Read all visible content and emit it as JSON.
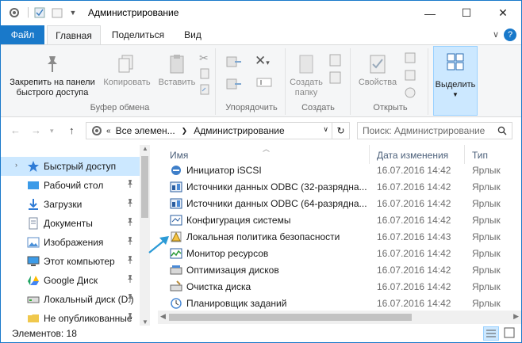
{
  "titlebar": {
    "title": "Администрирование",
    "minimize_glyph": "—",
    "maximize_glyph": "☐",
    "close_glyph": "✕"
  },
  "tabs": {
    "file": "Файл",
    "home": "Главная",
    "share": "Поделиться",
    "view": "Вид",
    "help": "?"
  },
  "ribbon": {
    "pin_label_1": "Закрепить на панели",
    "pin_label_2": "быстрого доступа",
    "copy": "Копировать",
    "paste": "Вставить",
    "group_clipboard": "Буфер обмена",
    "group_organize": "Упорядочить",
    "new_folder_1": "Создать",
    "new_folder_2": "папку",
    "group_create": "Создать",
    "properties": "Свойства",
    "group_open": "Открыть",
    "select": "Выделить"
  },
  "address": {
    "crumb_1": "Все элемен...",
    "crumb_2": "Администрирование",
    "search_placeholder": "Поиск: Администрирование"
  },
  "nav": {
    "items": [
      {
        "label": "Быстрый доступ",
        "icon": "star-icon",
        "pinned": false,
        "selected": true
      },
      {
        "label": "Рабочий стол",
        "icon": "desktop-icon",
        "pinned": true,
        "selected": false
      },
      {
        "label": "Загрузки",
        "icon": "download-icon",
        "pinned": true,
        "selected": false
      },
      {
        "label": "Документы",
        "icon": "documents-icon",
        "pinned": true,
        "selected": false
      },
      {
        "label": "Изображения",
        "icon": "pictures-icon",
        "pinned": true,
        "selected": false
      },
      {
        "label": "Этот компьютер",
        "icon": "computer-icon",
        "pinned": true,
        "selected": false
      },
      {
        "label": "Google Диск",
        "icon": "google-drive-icon",
        "pinned": true,
        "selected": false
      },
      {
        "label": "Локальный диск (D:)",
        "icon": "drive-icon",
        "pinned": true,
        "selected": false
      },
      {
        "label": "Не опубликованные",
        "icon": "folder-icon",
        "pinned": true,
        "selected": false
      }
    ]
  },
  "columns": {
    "name": "Имя",
    "date": "Дата изменения",
    "type": "Тип"
  },
  "files": [
    {
      "name": "Инициатор iSCSI",
      "date": "16.07.2016 14:42",
      "type": "Ярлык"
    },
    {
      "name": "Источники данных ODBC (32-разрядна...",
      "date": "16.07.2016 14:42",
      "type": "Ярлык"
    },
    {
      "name": "Источники данных ODBC (64-разрядна...",
      "date": "16.07.2016 14:42",
      "type": "Ярлык"
    },
    {
      "name": "Конфигурация системы",
      "date": "16.07.2016 14:42",
      "type": "Ярлык"
    },
    {
      "name": "Локальная политика безопасности",
      "date": "16.07.2016 14:43",
      "type": "Ярлык"
    },
    {
      "name": "Монитор ресурсов",
      "date": "16.07.2016 14:42",
      "type": "Ярлык"
    },
    {
      "name": "Оптимизация дисков",
      "date": "16.07.2016 14:42",
      "type": "Ярлык"
    },
    {
      "name": "Очистка диска",
      "date": "16.07.2016 14:42",
      "type": "Ярлык"
    },
    {
      "name": "Планировщик заданий",
      "date": "16.07.2016 14:42",
      "type": "Ярлык"
    }
  ],
  "status": {
    "items_count": "Элементов: 18"
  },
  "colors": {
    "accent": "#1979ca",
    "selection": "#cce8ff",
    "ribbon_bg": "#f5f6f7",
    "arrow": "#2b9ad6"
  }
}
